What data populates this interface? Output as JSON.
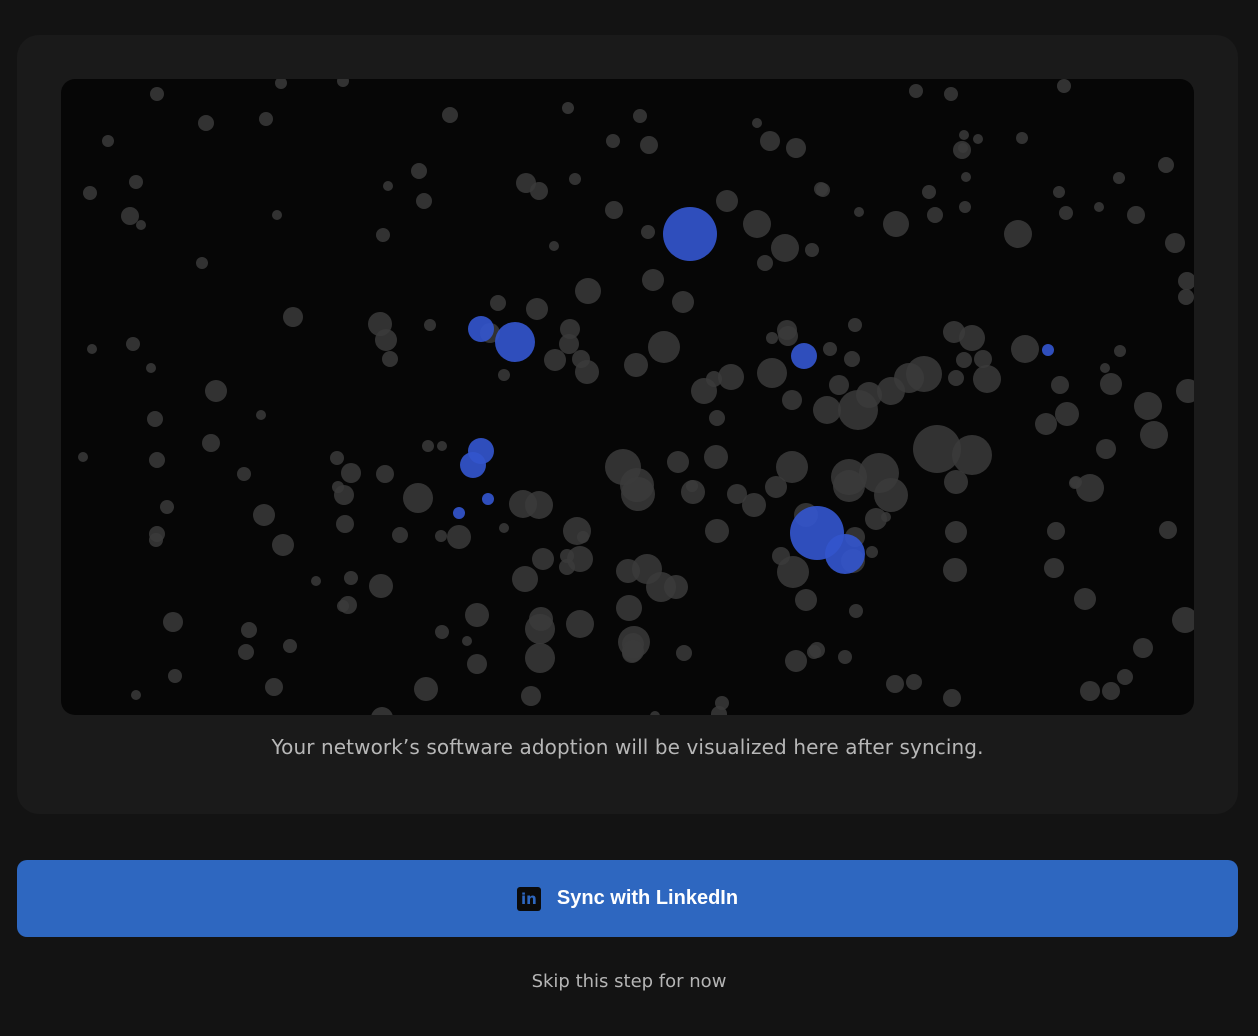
{
  "visualization": {
    "caption": "Your network’s software adoption will be visualized here after syncing.",
    "colors": {
      "background": "#060606",
      "neutral_node": "#3b3b3b",
      "highlight_node": "#3355cc"
    }
  },
  "sync_button": {
    "label": "Sync with LinkedIn",
    "icon": "linkedin-icon",
    "icon_text": "in",
    "color": "#2e67c0"
  },
  "skip_link": {
    "label": "Skip this step for now"
  }
}
